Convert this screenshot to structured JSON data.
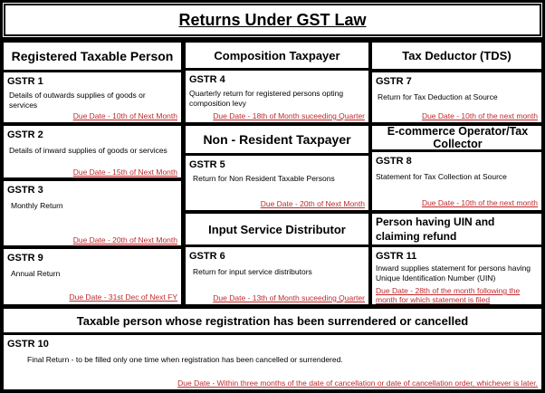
{
  "title": "Returns Under GST Law",
  "sections": {
    "registered": "Registered Taxable Person",
    "composition": "Composition Taxpayer",
    "tds": "Tax Deductor (TDS)",
    "non_resident": "Non - Resident Taxpayer",
    "ecommerce": "E-commerce Operator/Tax Collector",
    "isd": "Input Service Distributor",
    "uin": "Person having UIN and claiming refund",
    "cancelled": "Taxable person whose registration has been surrendered or cancelled"
  },
  "returns": {
    "gstr1": {
      "name": "GSTR 1",
      "desc": "Details of outwards supplies of goods or services",
      "due": "Due Date - 10th of Next Month"
    },
    "gstr2": {
      "name": "GSTR 2",
      "desc": "Details of inward supplies of goods or services",
      "due": "Due Date - 15th of Next Month"
    },
    "gstr3": {
      "name": "GSTR 3",
      "desc": "Monthly Return",
      "due": "Due Date - 20th of Next Month"
    },
    "gstr9": {
      "name": "GSTR 9",
      "desc": "Annual Return",
      "due": "Due Date - 31st Dec of Next FY"
    },
    "gstr4": {
      "name": "GSTR 4",
      "desc": "Quarterly return for registered persons opting composition levy",
      "due": "Due Date - 18th of Month suceeding Quarter"
    },
    "gstr5": {
      "name": "GSTR 5",
      "desc": "Return for Non Resident Taxable Persons",
      "due": "Due Date - 20th of Next Month"
    },
    "gstr6": {
      "name": "GSTR 6",
      "desc": "Return for input service distributors",
      "due": "Due Date - 13th of Month suceeding Quarter"
    },
    "gstr7": {
      "name": "GSTR 7",
      "desc": "Return for Tax Deduction at Source",
      "due": "Due Date - 10th of the next month"
    },
    "gstr8": {
      "name": "GSTR 8",
      "desc": "Statement for Tax Collection at Source",
      "due": "Due Date - 10th of the next month"
    },
    "gstr11": {
      "name": "GSTR 11",
      "desc": "Inward supplies statement for persons having Unique Identification Number (UIN)",
      "due": "Due Date - 28th of the month following the month for which statement is filed"
    },
    "gstr10": {
      "name": "GSTR 10",
      "desc": "Final Return - to be filled only one time when registration has been cancelled or surrendered.",
      "due": "Due Date - Within three months of the date of cancellation or date of cancellation order, whichever is later."
    }
  }
}
